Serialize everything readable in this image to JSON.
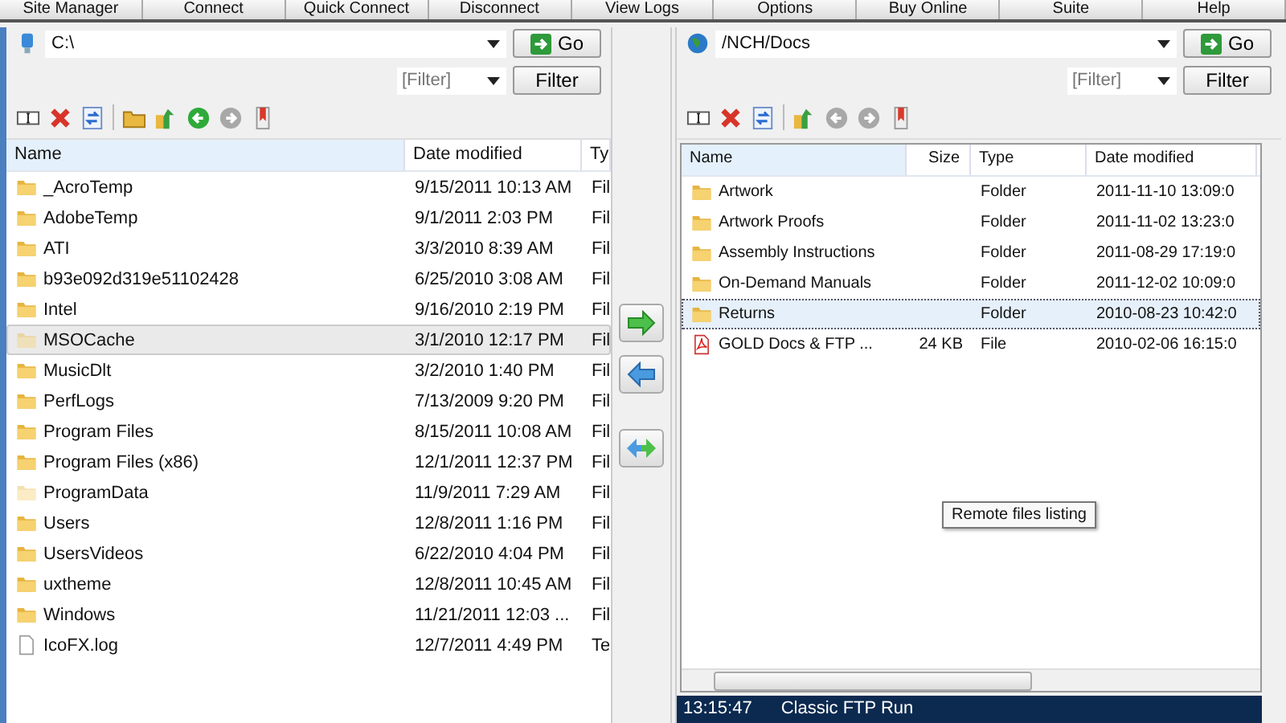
{
  "menu": [
    "Site Manager",
    "Connect",
    "Quick Connect",
    "Disconnect",
    "View Logs",
    "Options",
    "Buy Online",
    "Suite",
    "Help"
  ],
  "local": {
    "path": "C:\\",
    "go": "Go",
    "filter_placeholder": "[Filter]",
    "filter_button": "Filter",
    "toolbar": [
      {
        "kind": "rename",
        "disabled": false
      },
      {
        "kind": "delete",
        "disabled": false
      },
      {
        "kind": "refresh",
        "disabled": false
      },
      {
        "kind": "sep",
        "disabled": false
      },
      {
        "kind": "newfolder",
        "disabled": false
      },
      {
        "kind": "up",
        "disabled": false
      },
      {
        "kind": "back",
        "disabled": false
      },
      {
        "kind": "forward",
        "disabled": true
      },
      {
        "kind": "bookmark",
        "disabled": false
      }
    ],
    "columns": [
      "Name",
      "Date modified",
      "Ty"
    ],
    "rows": [
      {
        "kind": "folder",
        "name": "_AcroTemp",
        "date": "9/15/2011 10:13 AM",
        "type": "Fil",
        "hidden": false,
        "selected": false
      },
      {
        "kind": "folder",
        "name": "AdobeTemp",
        "date": "9/1/2011 2:03 PM",
        "type": "Fil",
        "hidden": false,
        "selected": false
      },
      {
        "kind": "folder",
        "name": "ATI",
        "date": "3/3/2010 8:39 AM",
        "type": "Fil",
        "hidden": false,
        "selected": false
      },
      {
        "kind": "folder",
        "name": "b93e092d319e51102428",
        "date": "6/25/2010 3:08 AM",
        "type": "Fil",
        "hidden": false,
        "selected": false
      },
      {
        "kind": "folder",
        "name": "Intel",
        "date": "9/16/2010 2:19 PM",
        "type": "Fil",
        "hidden": false,
        "selected": false
      },
      {
        "kind": "folder",
        "name": "MSOCache",
        "date": "3/1/2010 12:17 PM",
        "type": "Fil",
        "hidden": true,
        "selected": true
      },
      {
        "kind": "folder",
        "name": "MusicDlt",
        "date": "3/2/2010 1:40 PM",
        "type": "Fil",
        "hidden": false,
        "selected": false
      },
      {
        "kind": "folder",
        "name": "PerfLogs",
        "date": "7/13/2009 9:20 PM",
        "type": "Fil",
        "hidden": false,
        "selected": false
      },
      {
        "kind": "folder",
        "name": "Program Files",
        "date": "8/15/2011 10:08 AM",
        "type": "Fil",
        "hidden": false,
        "selected": false
      },
      {
        "kind": "folder",
        "name": "Program Files (x86)",
        "date": "12/1/2011 12:37 PM",
        "type": "Fil",
        "hidden": false,
        "selected": false
      },
      {
        "kind": "folder",
        "name": "ProgramData",
        "date": "11/9/2011 7:29 AM",
        "type": "Fil",
        "hidden": true,
        "selected": false
      },
      {
        "kind": "folder",
        "name": "Users",
        "date": "12/8/2011 1:16 PM",
        "type": "Fil",
        "hidden": false,
        "selected": false
      },
      {
        "kind": "folder",
        "name": "UsersVideos",
        "date": "6/22/2010 4:04 PM",
        "type": "Fil",
        "hidden": false,
        "selected": false
      },
      {
        "kind": "folder",
        "name": "uxtheme",
        "date": "12/8/2011 10:45 AM",
        "type": "Fil",
        "hidden": false,
        "selected": false
      },
      {
        "kind": "folder",
        "name": "Windows",
        "date": "11/21/2011 12:03 ...",
        "type": "Fil",
        "hidden": false,
        "selected": false
      },
      {
        "kind": "file",
        "name": "IcoFX.log",
        "date": "12/7/2011 4:49 PM",
        "type": "Te",
        "hidden": false,
        "selected": false
      }
    ]
  },
  "transfer_buttons": [
    {
      "kind": "upload"
    },
    {
      "kind": "download"
    },
    {
      "kind": "sync"
    }
  ],
  "remote": {
    "path": "/NCH/Docs",
    "go": "Go",
    "filter_placeholder": "[Filter]",
    "filter_button": "Filter",
    "toolbar": [
      {
        "kind": "rename",
        "disabled": false
      },
      {
        "kind": "delete",
        "disabled": false
      },
      {
        "kind": "refresh",
        "disabled": false
      },
      {
        "kind": "sep",
        "disabled": false
      },
      {
        "kind": "up",
        "disabled": false
      },
      {
        "kind": "back",
        "disabled": true
      },
      {
        "kind": "forward",
        "disabled": true
      },
      {
        "kind": "bookmark",
        "disabled": false
      }
    ],
    "columns": [
      "Name",
      "Size",
      "Type",
      "Date modified"
    ],
    "rows": [
      {
        "kind": "folder",
        "name": "Artwork",
        "size": "",
        "type": "Folder",
        "date": "2011-11-10 13:09:0",
        "selected": false
      },
      {
        "kind": "folder",
        "name": "Artwork Proofs",
        "size": "",
        "type": "Folder",
        "date": "2011-11-02 13:23:0",
        "selected": false
      },
      {
        "kind": "folder",
        "name": "Assembly Instructions",
        "size": "",
        "type": "Folder",
        "date": "2011-08-29 17:19:0",
        "selected": false
      },
      {
        "kind": "folder",
        "name": "On-Demand Manuals",
        "size": "",
        "type": "Folder",
        "date": "2011-12-02 10:09:0",
        "selected": false
      },
      {
        "kind": "folder",
        "name": "Returns",
        "size": "",
        "type": "Folder",
        "date": "2010-08-23 10:42:0",
        "selected": true
      },
      {
        "kind": "pdf",
        "name": "GOLD Docs & FTP ...",
        "size": "24 KB",
        "type": "File",
        "date": "2010-02-06 16:15:0",
        "selected": false
      }
    ],
    "tooltip": "Remote files listing",
    "log": [
      {
        "time": "13:15:47",
        "message": "Classic FTP Run"
      }
    ]
  }
}
